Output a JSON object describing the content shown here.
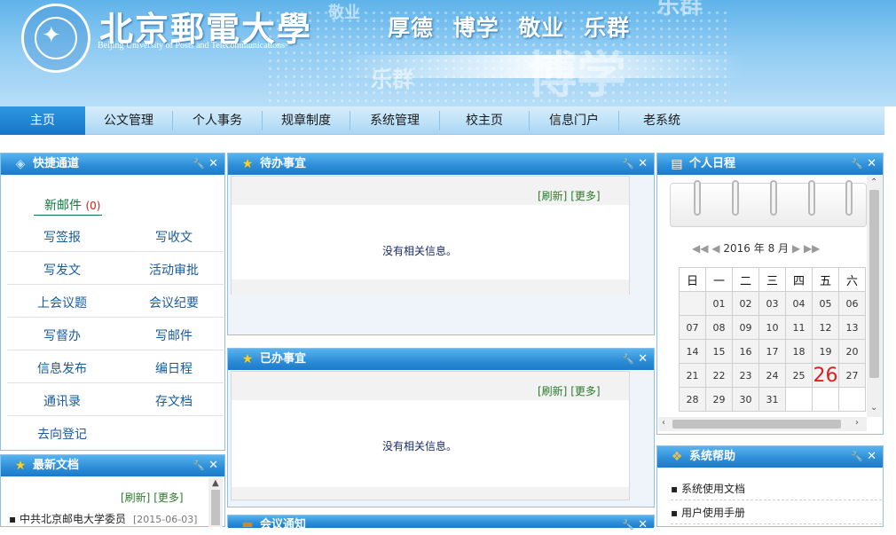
{
  "header": {
    "university_cn": "北京郵電大學",
    "university_en": "Beijing University of Posts and Telecommunications",
    "motto": "厚德 博学 敬业 乐群",
    "watermarks": [
      "敬业",
      "乐群",
      "博学",
      "乐群"
    ],
    "logo_icon": "bupt-seal-icon"
  },
  "nav": {
    "items": [
      "主页",
      "公文管理",
      "个人事务",
      "规章制度",
      "系统管理",
      "校主页",
      "信息门户",
      "老系统"
    ],
    "active_index": 0
  },
  "quick_access": {
    "title": "快捷通道",
    "mail_label": "新邮件",
    "mail_count": "(0)",
    "links": [
      "写签报",
      "写收文",
      "写发文",
      "活动审批",
      "上会议题",
      "会议纪要",
      "写督办",
      "写邮件",
      "信息发布",
      "编日程",
      "通讯录",
      "存文档",
      "去向登记"
    ]
  },
  "latest_docs": {
    "title": "最新文档",
    "refresh": "[刷新]",
    "more": "[更多]",
    "items": [
      {
        "title": "中共北京邮电大学委员",
        "date": "[2015-06-03]"
      }
    ]
  },
  "todo": {
    "title": "待办事宜",
    "refresh": "[刷新]",
    "more": "[更多]",
    "empty_text": "没有相关信息。"
  },
  "done": {
    "title": "已办事宜",
    "refresh": "[刷新]",
    "more": "[更多]",
    "empty_text": "没有相关信息。"
  },
  "meeting": {
    "title": "会议通知"
  },
  "calendar": {
    "title": "个人日程",
    "year": "2016",
    "year_label": "年",
    "month": "8",
    "month_label": "月",
    "weekdays": [
      "日",
      "一",
      "二",
      "三",
      "四",
      "五",
      "六"
    ],
    "weeks": [
      [
        "",
        "01",
        "02",
        "03",
        "04",
        "05",
        "06"
      ],
      [
        "07",
        "08",
        "09",
        "10",
        "11",
        "12",
        "13"
      ],
      [
        "14",
        "15",
        "16",
        "17",
        "18",
        "19",
        "20"
      ],
      [
        "21",
        "22",
        "23",
        "24",
        "25",
        "26",
        "27"
      ],
      [
        "28",
        "29",
        "30",
        "31",
        "",
        "",
        ""
      ]
    ],
    "today": "26",
    "today_color": "#e02020"
  },
  "help": {
    "title": "系统帮助",
    "items": [
      "系统使用文档",
      "用户使用手册"
    ]
  },
  "colors": {
    "nav_active": "#1576c9",
    "panel_header": "#2f8fd8",
    "link_green": "#2b7a2b"
  }
}
